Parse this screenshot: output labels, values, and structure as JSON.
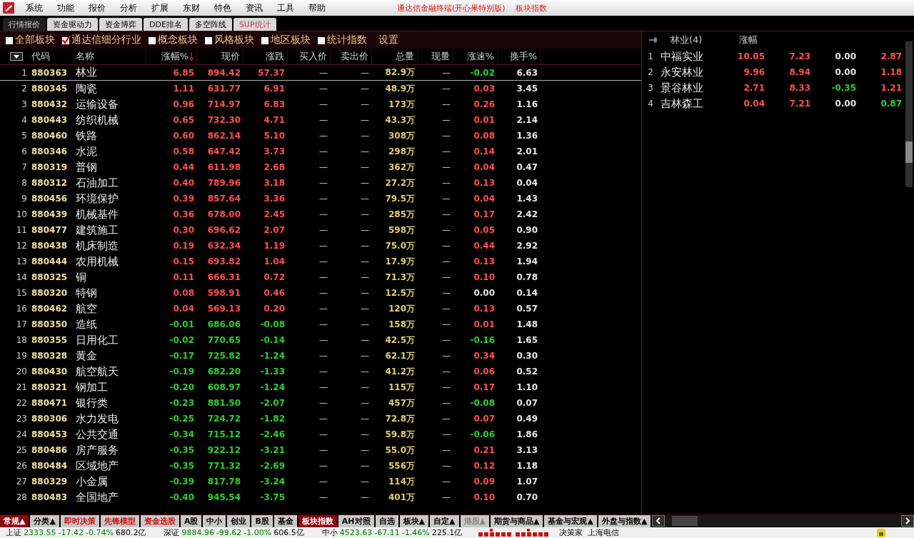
{
  "menu": {
    "items": [
      "系统",
      "功能",
      "报价",
      "分析",
      "扩展",
      "东财",
      "特色",
      "资讯",
      "工具",
      "帮助"
    ],
    "title": "通达信金融终端(开心果特别版)",
    "subtitle": "板块指数"
  },
  "top_tabs": [
    {
      "label": "行情报价",
      "selected": true,
      "kind": "normal"
    },
    {
      "label": "资金驱动力",
      "selected": false,
      "kind": "normal"
    },
    {
      "label": "资金博弈",
      "selected": false,
      "kind": "normal"
    },
    {
      "label": "DDE排名",
      "selected": false,
      "kind": "normal"
    },
    {
      "label": "多空阵线",
      "selected": false,
      "kind": "normal"
    },
    {
      "label": "SUP统计",
      "selected": false,
      "kind": "special"
    }
  ],
  "filters": [
    {
      "label": "全部板块",
      "checked": false
    },
    {
      "label": "通达信细分行业",
      "checked": true
    },
    {
      "label": "概念板块",
      "checked": false
    },
    {
      "label": "风格板块",
      "checked": false
    },
    {
      "label": "地区板块",
      "checked": false
    },
    {
      "label": "统计指数",
      "checked": false
    }
  ],
  "settings_link": "设置",
  "table": {
    "columns": [
      "代码",
      "名称",
      "涨幅%",
      "现价",
      "涨跌",
      "买入价",
      "卖出价",
      "总量",
      "现量",
      "涨速%",
      "换手%"
    ],
    "rows": [
      {
        "no": "1",
        "code": "880363",
        "name": "林业",
        "change_pct": "6.85",
        "price": "894.42",
        "change": "57.37",
        "bid": "—",
        "ask": "—",
        "volume": "82.9万",
        "last_volume": "—",
        "speed": {
          "text": "-0.02",
          "color": "#30d030"
        },
        "turnover": "6.63",
        "color": "#ff5050",
        "selected": true
      },
      {
        "no": "2",
        "code": "880345",
        "name": "陶瓷",
        "change_pct": "1.11",
        "price": "631.77",
        "change": "6.91",
        "bid": "—",
        "ask": "—",
        "volume": "48.9万",
        "last_volume": "—",
        "speed": {
          "text": "0.03",
          "color": "#ff5050"
        },
        "turnover": "3.45",
        "color": "#ff5050",
        "selected": false
      },
      {
        "no": "3",
        "code": "880432",
        "name": "运输设备",
        "change_pct": "0.96",
        "price": "714.97",
        "change": "6.83",
        "bid": "—",
        "ask": "—",
        "volume": "173万",
        "last_volume": "—",
        "speed": {
          "text": "0.26",
          "color": "#ff5050"
        },
        "turnover": "1.16",
        "color": "#ff5050",
        "selected": false
      },
      {
        "no": "4",
        "code": "880443",
        "name": "纺织机械",
        "change_pct": "0.65",
        "price": "732.30",
        "change": "4.71",
        "bid": "—",
        "ask": "—",
        "volume": "43.3万",
        "last_volume": "—",
        "speed": {
          "text": "0.01",
          "color": "#ff5050"
        },
        "turnover": "2.14",
        "color": "#ff5050",
        "selected": false
      },
      {
        "no": "5",
        "code": "880460",
        "name": "铁路",
        "change_pct": "0.60",
        "price": "862.14",
        "change": "5.10",
        "bid": "—",
        "ask": "—",
        "volume": "308万",
        "last_volume": "—",
        "speed": {
          "text": "0.08",
          "color": "#ff5050"
        },
        "turnover": "1.36",
        "color": "#ff5050",
        "selected": false
      },
      {
        "no": "6",
        "code": "880346",
        "name": "水泥",
        "change_pct": "0.58",
        "price": "647.42",
        "change": "3.73",
        "bid": "—",
        "ask": "—",
        "volume": "298万",
        "last_volume": "—",
        "speed": {
          "text": "0.14",
          "color": "#ff5050"
        },
        "turnover": "2.01",
        "color": "#ff5050",
        "selected": false
      },
      {
        "no": "7",
        "code": "880319",
        "name": "普钢",
        "change_pct": "0.44",
        "price": "611.98",
        "change": "2.68",
        "bid": "—",
        "ask": "—",
        "volume": "362万",
        "last_volume": "—",
        "speed": {
          "text": "0.04",
          "color": "#ff5050"
        },
        "turnover": "0.47",
        "color": "#ff5050",
        "selected": false
      },
      {
        "no": "8",
        "code": "880312",
        "name": "石油加工",
        "change_pct": "0.40",
        "price": "789.96",
        "change": "3.18",
        "bid": "—",
        "ask": "—",
        "volume": "27.2万",
        "last_volume": "—",
        "speed": {
          "text": "0.13",
          "color": "#ff5050"
        },
        "turnover": "0.04",
        "color": "#ff5050",
        "selected": false
      },
      {
        "no": "9",
        "code": "880456",
        "name": "环境保护",
        "change_pct": "0.39",
        "price": "857.64",
        "change": "3.36",
        "bid": "—",
        "ask": "—",
        "volume": "79.5万",
        "last_volume": "—",
        "speed": {
          "text": "0.04",
          "color": "#ff5050"
        },
        "turnover": "1.43",
        "color": "#ff5050",
        "selected": false
      },
      {
        "no": "10",
        "code": "880439",
        "name": "机械基件",
        "change_pct": "0.36",
        "price": "678.00",
        "change": "2.45",
        "bid": "—",
        "ask": "—",
        "volume": "285万",
        "last_volume": "—",
        "speed": {
          "text": "0.17",
          "color": "#ff5050"
        },
        "turnover": "2.42",
        "color": "#ff5050",
        "selected": false
      },
      {
        "no": "11",
        "code": "880477",
        "name": "建筑施工",
        "change_pct": "0.30",
        "price": "696.62",
        "change": "2.07",
        "bid": "—",
        "ask": "—",
        "volume": "598万",
        "last_volume": "—",
        "speed": {
          "text": "0.05",
          "color": "#ff5050"
        },
        "turnover": "0.90",
        "color": "#ff5050",
        "selected": false
      },
      {
        "no": "12",
        "code": "880438",
        "name": "机床制造",
        "change_pct": "0.19",
        "price": "632.34",
        "change": "1.19",
        "bid": "—",
        "ask": "—",
        "volume": "75.0万",
        "last_volume": "—",
        "speed": {
          "text": "0.44",
          "color": "#ff5050"
        },
        "turnover": "2.92",
        "color": "#ff5050",
        "selected": false
      },
      {
        "no": "13",
        "code": "880444",
        "name": "农用机械",
        "change_pct": "0.15",
        "price": "693.82",
        "change": "1.04",
        "bid": "—",
        "ask": "—",
        "volume": "17.9万",
        "last_volume": "—",
        "speed": {
          "text": "0.13",
          "color": "#ff5050"
        },
        "turnover": "1.94",
        "color": "#ff5050",
        "selected": false
      },
      {
        "no": "14",
        "code": "880325",
        "name": "铜",
        "change_pct": "0.11",
        "price": "666.31",
        "change": "0.72",
        "bid": "—",
        "ask": "—",
        "volume": "71.3万",
        "last_volume": "—",
        "speed": {
          "text": "0.10",
          "color": "#ff5050"
        },
        "turnover": "0.78",
        "color": "#ff5050",
        "selected": false
      },
      {
        "no": "15",
        "code": "880320",
        "name": "特钢",
        "change_pct": "0.08",
        "price": "598.91",
        "change": "0.46",
        "bid": "—",
        "ask": "—",
        "volume": "12.5万",
        "last_volume": "—",
        "speed": {
          "text": "0.00",
          "color": "#e8e8e8"
        },
        "turnover": "0.14",
        "color": "#ff5050",
        "selected": false
      },
      {
        "no": "16",
        "code": "880462",
        "name": "航空",
        "change_pct": "0.04",
        "price": "569.13",
        "change": "0.20",
        "bid": "—",
        "ask": "—",
        "volume": "120万",
        "last_volume": "—",
        "speed": {
          "text": "0.13",
          "color": "#ff5050"
        },
        "turnover": "0.57",
        "color": "#ff5050",
        "selected": false
      },
      {
        "no": "17",
        "code": "880350",
        "name": "造纸",
        "change_pct": "-0.01",
        "price": "686.06",
        "change": "-0.08",
        "bid": "—",
        "ask": "—",
        "volume": "158万",
        "last_volume": "—",
        "speed": {
          "text": "0.01",
          "color": "#ff5050"
        },
        "turnover": "1.48",
        "color": "#30d030",
        "selected": false
      },
      {
        "no": "18",
        "code": "880355",
        "name": "日用化工",
        "change_pct": "-0.02",
        "price": "770.65",
        "change": "-0.14",
        "bid": "—",
        "ask": "—",
        "volume": "42.5万",
        "last_volume": "—",
        "speed": {
          "text": "-0.16",
          "color": "#30d030"
        },
        "turnover": "1.65",
        "color": "#30d030",
        "selected": false
      },
      {
        "no": "19",
        "code": "880328",
        "name": "黄金",
        "change_pct": "-0.17",
        "price": "725.82",
        "change": "-1.24",
        "bid": "—",
        "ask": "—",
        "volume": "62.1万",
        "last_volume": "—",
        "speed": {
          "text": "0.34",
          "color": "#ff5050"
        },
        "turnover": "0.30",
        "color": "#30d030",
        "selected": false
      },
      {
        "no": "20",
        "code": "880430",
        "name": "航空航天",
        "change_pct": "-0.19",
        "price": "682.20",
        "change": "-1.33",
        "bid": "—",
        "ask": "—",
        "volume": "41.2万",
        "last_volume": "—",
        "speed": {
          "text": "0.06",
          "color": "#ff5050"
        },
        "turnover": "0.52",
        "color": "#30d030",
        "selected": false
      },
      {
        "no": "21",
        "code": "880321",
        "name": "钢加工",
        "change_pct": "-0.20",
        "price": "608.97",
        "change": "-1.24",
        "bid": "—",
        "ask": "—",
        "volume": "115万",
        "last_volume": "—",
        "speed": {
          "text": "0.17",
          "color": "#ff5050"
        },
        "turnover": "1.10",
        "color": "#30d030",
        "selected": false
      },
      {
        "no": "22",
        "code": "880471",
        "name": "银行类",
        "change_pct": "-0.23",
        "price": "881.50",
        "change": "-2.07",
        "bid": "—",
        "ask": "—",
        "volume": "457万",
        "last_volume": "—",
        "speed": {
          "text": "-0.08",
          "color": "#30d030"
        },
        "turnover": "0.07",
        "color": "#30d030",
        "selected": false
      },
      {
        "no": "23",
        "code": "880306",
        "name": "水力发电",
        "change_pct": "-0.25",
        "price": "724.72",
        "change": "-1.82",
        "bid": "—",
        "ask": "—",
        "volume": "72.8万",
        "last_volume": "—",
        "speed": {
          "text": "0.07",
          "color": "#ff5050"
        },
        "turnover": "0.49",
        "color": "#30d030",
        "selected": false
      },
      {
        "no": "24",
        "code": "880453",
        "name": "公共交通",
        "change_pct": "-0.34",
        "price": "715.12",
        "change": "-2.46",
        "bid": "—",
        "ask": "—",
        "volume": "59.8万",
        "last_volume": "—",
        "speed": {
          "text": "-0.06",
          "color": "#30d030"
        },
        "turnover": "1.86",
        "color": "#30d030",
        "selected": false
      },
      {
        "no": "25",
        "code": "880486",
        "name": "房产服务",
        "change_pct": "-0.35",
        "price": "922.12",
        "change": "-3.21",
        "bid": "—",
        "ask": "—",
        "volume": "55.0万",
        "last_volume": "—",
        "speed": {
          "text": "0.21",
          "color": "#ff5050"
        },
        "turnover": "3.13",
        "color": "#30d030",
        "selected": false
      },
      {
        "no": "26",
        "code": "880484",
        "name": "区域地产",
        "change_pct": "-0.35",
        "price": "771.32",
        "change": "-2.69",
        "bid": "—",
        "ask": "—",
        "volume": "556万",
        "last_volume": "—",
        "speed": {
          "text": "0.12",
          "color": "#ff5050"
        },
        "turnover": "1.18",
        "color": "#30d030",
        "selected": false
      },
      {
        "no": "27",
        "code": "880329",
        "name": "小金属",
        "change_pct": "-0.39",
        "price": "817.78",
        "change": "-3.24",
        "bid": "—",
        "ask": "—",
        "volume": "114万",
        "last_volume": "—",
        "speed": {
          "text": "0.09",
          "color": "#ff5050"
        },
        "turnover": "1.07",
        "color": "#30d030",
        "selected": false
      },
      {
        "no": "28",
        "code": "880483",
        "name": "全国地产",
        "change_pct": "-0.40",
        "price": "945.54",
        "change": "-3.75",
        "bid": "—",
        "ask": "—",
        "volume": "401万",
        "last_volume": "—",
        "speed": {
          "text": "0.10",
          "color": "#ff5050"
        },
        "turnover": "0.70",
        "color": "#30d030",
        "selected": false
      }
    ]
  },
  "members": {
    "title": "林业(4)",
    "columns": [
      "涨幅"
    ],
    "rows": [
      {
        "no": "1",
        "name": "中福实业",
        "cells": [
          {
            "text": "10.05",
            "color": "#ff5050"
          },
          {
            "text": "7.23",
            "color": "#ff5050"
          },
          {
            "text": "0.00",
            "color": "#e8e8e8"
          },
          {
            "text": "2.87",
            "color": "#ff5050"
          }
        ]
      },
      {
        "no": "2",
        "name": "永安林业",
        "cells": [
          {
            "text": "9.96",
            "color": "#ff5050"
          },
          {
            "text": "8.94",
            "color": "#ff5050"
          },
          {
            "text": "0.00",
            "color": "#e8e8e8"
          },
          {
            "text": "1.18",
            "color": "#ff5050"
          }
        ]
      },
      {
        "no": "3",
        "name": "景谷林业",
        "cells": [
          {
            "text": "2.71",
            "color": "#ff5050"
          },
          {
            "text": "8.33",
            "color": "#ff5050"
          },
          {
            "text": "-0.35",
            "color": "#30d030"
          },
          {
            "text": "1.21",
            "color": "#ff5050"
          }
        ]
      },
      {
        "no": "4",
        "name": "吉林森工",
        "cells": [
          {
            "text": "0.04",
            "color": "#ff5050"
          },
          {
            "text": "7.21",
            "color": "#ff5050"
          },
          {
            "text": "0.00",
            "color": "#e8e8e8"
          },
          {
            "text": "0.87",
            "color": "#30d030"
          }
        ]
      }
    ]
  },
  "bottom_tabs": [
    {
      "label": "常规▲",
      "selected": true,
      "kind": "normal"
    },
    {
      "label": "分类▲",
      "selected": false,
      "kind": "normal"
    },
    {
      "label": "即时决策",
      "selected": false,
      "kind": "red"
    },
    {
      "label": "先锋模型",
      "selected": false,
      "kind": "red"
    },
    {
      "label": "资金选股",
      "selected": false,
      "kind": "red"
    },
    {
      "label": "A股",
      "selected": false,
      "kind": "normal"
    },
    {
      "label": "中小",
      "selected": false,
      "kind": "normal"
    },
    {
      "label": "创业",
      "selected": false,
      "kind": "normal"
    },
    {
      "label": "B股",
      "selected": false,
      "kind": "normal"
    },
    {
      "label": "基金",
      "selected": false,
      "kind": "normal"
    },
    {
      "label": "板块指数",
      "selected": true,
      "kind": "normal"
    },
    {
      "label": "AH对照",
      "selected": false,
      "kind": "normal"
    },
    {
      "label": "自选",
      "selected": false,
      "kind": "normal"
    },
    {
      "label": "板块▲",
      "selected": false,
      "kind": "normal"
    },
    {
      "label": "自定▲",
      "selected": false,
      "kind": "normal"
    },
    {
      "label": "港股▲",
      "selected": false,
      "kind": "muted"
    },
    {
      "label": "期货与商品▲",
      "selected": false,
      "kind": "normal"
    },
    {
      "label": "基金与宏观▲",
      "selected": false,
      "kind": "normal"
    },
    {
      "label": "外盘与指数▲",
      "selected": false,
      "kind": "normal"
    }
  ],
  "status_bar": {
    "indices": [
      {
        "label": "上证",
        "value": "2333.55",
        "change": "-17.42",
        "pct": "-0.74%",
        "amount": "680.2亿",
        "color": "#008000"
      },
      {
        "label": "深证",
        "value": "9884.96",
        "change": "-99.62",
        "pct": "-1.00%",
        "amount": "606.5亿",
        "color": "#008000"
      },
      {
        "label": "中小",
        "value": "4523.63",
        "change": "-67.11",
        "pct": "-1.46%",
        "amount": "225.1亿",
        "color": "#008000"
      }
    ],
    "product": "决策家",
    "server": "上海电信"
  }
}
